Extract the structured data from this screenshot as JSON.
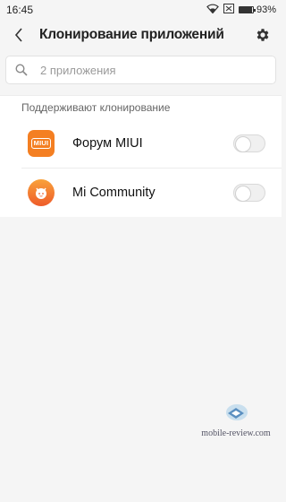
{
  "status_bar": {
    "time": "16:45",
    "battery_percent": "93%",
    "battery_level": 0.93
  },
  "header": {
    "title": "Клонирование приложений"
  },
  "search": {
    "placeholder": "2 приложения"
  },
  "section": {
    "title": "Поддерживают клонирование"
  },
  "apps": [
    {
      "name": "Форум MIUI",
      "icon": "miui-forum-icon",
      "icon_text": "MIUI",
      "enabled": false,
      "color": "#f47f22"
    },
    {
      "name": "Mi Community",
      "icon": "mi-community-icon",
      "enabled": false,
      "color": "#f47f22"
    }
  ],
  "watermark": {
    "text": "mobile-review.com"
  },
  "colors": {
    "background": "#f5f5f5",
    "card": "#ffffff",
    "accent": "#f47f22"
  }
}
